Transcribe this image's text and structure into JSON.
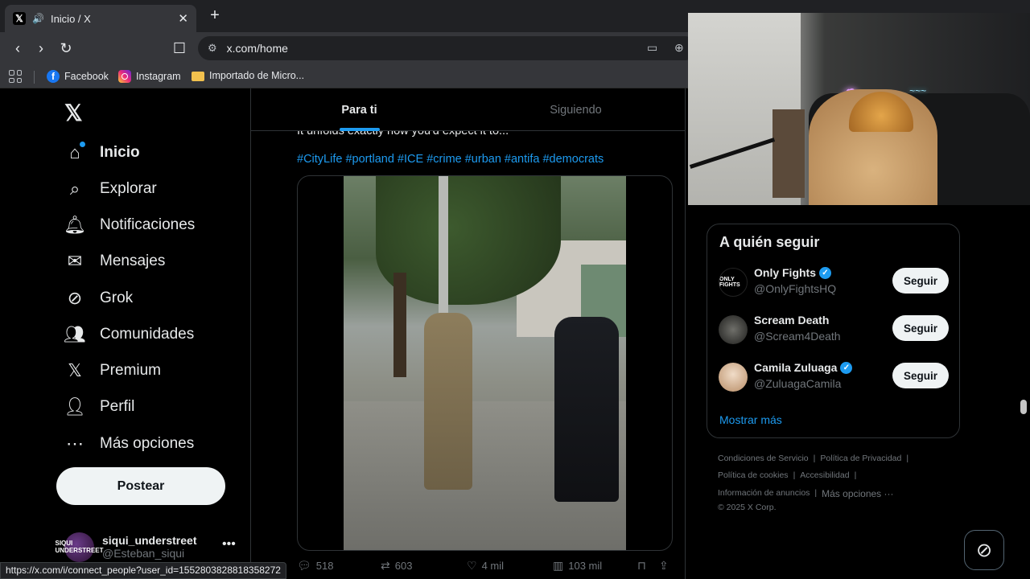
{
  "browser": {
    "tab_title": "Inicio / X",
    "tab_close": "✕",
    "new_tab": "+",
    "url": "x.com/home",
    "bookmarks": [
      "Facebook",
      "Instagram",
      "Importado de Micro..."
    ],
    "status_url": "https://x.com/i/connect_people?user_id=1552803828818358272"
  },
  "sidebar": {
    "items": [
      {
        "label": "Inicio",
        "icon": "home-icon"
      },
      {
        "label": "Explorar",
        "icon": "search-icon"
      },
      {
        "label": "Notificaciones",
        "icon": "bell-icon"
      },
      {
        "label": "Mensajes",
        "icon": "mail-icon"
      },
      {
        "label": "Grok",
        "icon": "grok-icon"
      },
      {
        "label": "Comunidades",
        "icon": "communities-icon"
      },
      {
        "label": "Premium",
        "icon": "x-premium-icon"
      },
      {
        "label": "Perfil",
        "icon": "person-icon"
      },
      {
        "label": "Más opciones",
        "icon": "more-circle-icon"
      }
    ],
    "post_label": "Postear",
    "account": {
      "name": "siqui_understreet",
      "handle": "@Esteban_siqui",
      "avatar_text": "SIQUI UNDERSTREET"
    }
  },
  "feed": {
    "tabs": [
      "Para ti",
      "Siguiendo"
    ],
    "tweet_text": "It unfolds exactly how you'd expect it to...",
    "hashtags": "#CityLife #portland #ICE #crime #urban #antifa #democrats",
    "actions": {
      "replies": "518",
      "reposts": "603",
      "likes": "4 mil",
      "views": "103 mil"
    }
  },
  "who_to_follow": {
    "title": "A quién seguir",
    "follow_label": "Seguir",
    "show_more": "Mostrar más",
    "accounts": [
      {
        "name": "Only Fights",
        "handle": "@OnlyFightsHQ",
        "verified": true,
        "avatar_text": "ONLY FIGHTS"
      },
      {
        "name": "Scream Death",
        "handle": "@Scream4Death",
        "verified": false,
        "avatar_text": ""
      },
      {
        "name": "Camila Zuluaga",
        "handle": "@ZuluagaCamila",
        "verified": true,
        "avatar_text": ""
      }
    ]
  },
  "footer": {
    "links": [
      "Condiciones de Servicio",
      "Política de Privacidad",
      "Política de cookies",
      "Accesibilidad",
      "Información de anuncios",
      "Más opciones ···"
    ],
    "copyright": "© 2025 X Corp."
  },
  "colors": {
    "accent": "#1d9bf0",
    "background": "#000000",
    "text": "#e7e9ea",
    "muted": "#71767b"
  }
}
